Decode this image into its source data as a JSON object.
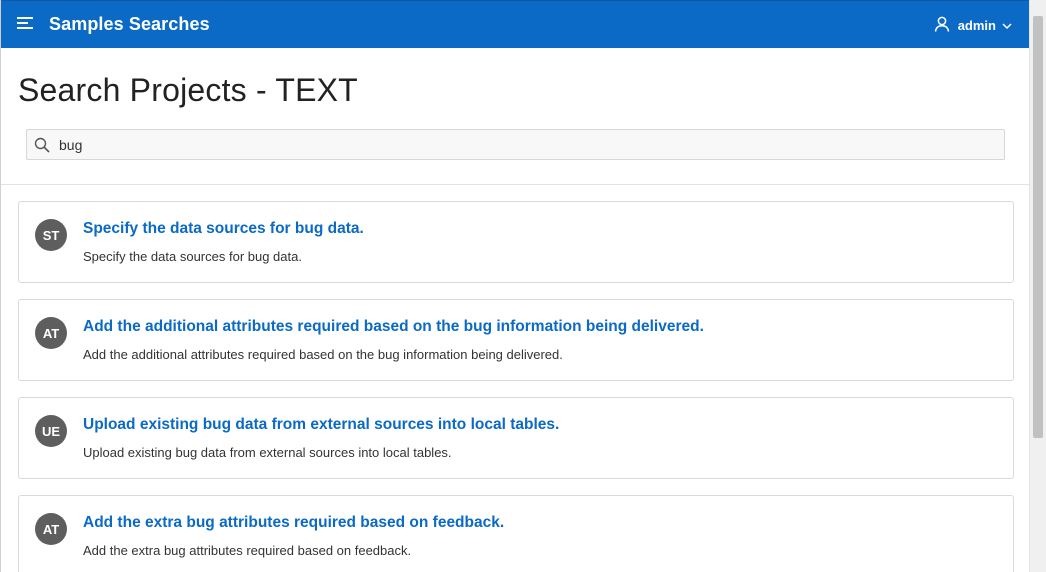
{
  "header": {
    "app_title": "Samples Searches",
    "user_name": "admin",
    "icons": {
      "menu": "hamburger-icon",
      "user": "user-icon",
      "dropdown": "chevron-down-icon"
    },
    "colors": {
      "brand": "#0a6ac6"
    }
  },
  "page": {
    "title": "Search Projects - TEXT"
  },
  "search": {
    "value": "bug",
    "icon": "search-icon"
  },
  "results": [
    {
      "initials": "ST",
      "title": "Specify the data sources for bug data.",
      "description": "Specify the data sources for bug data."
    },
    {
      "initials": "AT",
      "title": "Add the additional attributes required based on the bug information being delivered.",
      "description": "Add the additional attributes required based on the bug information being delivered."
    },
    {
      "initials": "UE",
      "title": "Upload existing bug data from external sources into local tables.",
      "description": "Upload existing bug data from external sources into local tables."
    },
    {
      "initials": "AT",
      "title": "Add the extra bug attributes required based on feedback.",
      "description": "Add the extra bug attributes required based on feedback."
    }
  ]
}
